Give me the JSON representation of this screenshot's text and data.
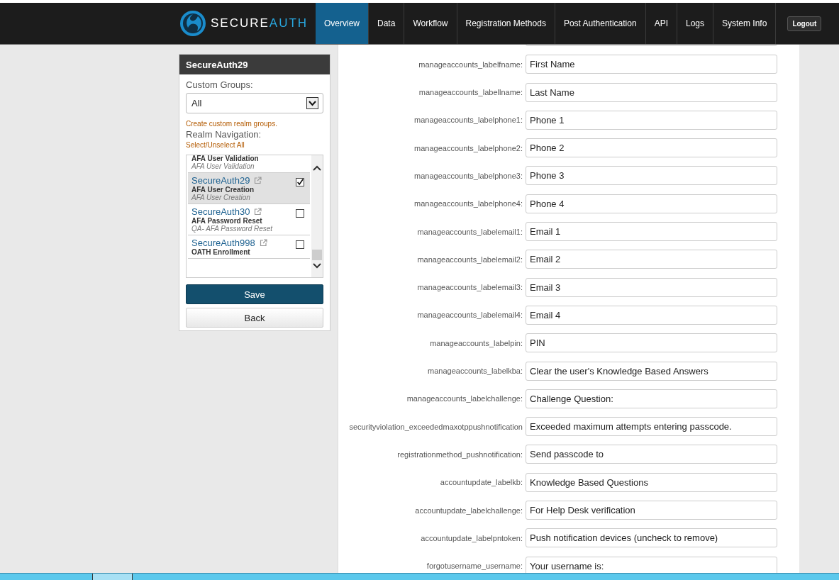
{
  "header": {
    "logo": {
      "word_1": "SECURE",
      "word_2": "AUTH"
    },
    "nav": [
      {
        "label": "Overview",
        "selected": true
      },
      {
        "label": "Data",
        "selected": false
      },
      {
        "label": "Workflow",
        "selected": false
      },
      {
        "label": "Registration Methods",
        "selected": false
      },
      {
        "label": "Post Authentication",
        "selected": false
      },
      {
        "label": "API",
        "selected": false
      },
      {
        "label": "Logs",
        "selected": false
      },
      {
        "label": "System Info",
        "selected": false
      }
    ],
    "logout": "Logout"
  },
  "sidebar": {
    "title": "SecureAuth29",
    "groups_label": "Custom Groups:",
    "groups_value": "All",
    "create_link": "Create custom realm groups.",
    "nav_label": "Realm Navigation:",
    "select_all": "Select/Unselect All",
    "realms": [
      {
        "description": "AFA User Validation",
        "subtitle": "AFA User Validation",
        "selected": false
      },
      {
        "name": "SecureAuth29",
        "description": "AFA User Creation",
        "subtitle": "AFA User Creation",
        "checked": true,
        "selected": true
      },
      {
        "name": "SecureAuth30",
        "description": "AFA Password Reset",
        "subtitle": "QA- AFA Password Reset",
        "checked": false,
        "selected": false
      },
      {
        "name": "SecureAuth998",
        "description": "OATH Enrollment",
        "checked": false,
        "selected": false
      }
    ],
    "save": "Save",
    "back": "Back"
  },
  "form": {
    "rows": [
      {
        "label": "manageaccounts_labelfname:",
        "value": "First Name"
      },
      {
        "label": "manageaccounts_labellname:",
        "value": "Last Name"
      },
      {
        "label": "manageaccounts_labelphone1:",
        "value": "Phone 1"
      },
      {
        "label": "manageaccounts_labelphone2:",
        "value": "Phone 2"
      },
      {
        "label": "manageaccounts_labelphone3:",
        "value": "Phone 3"
      },
      {
        "label": "manageaccounts_labelphone4:",
        "value": "Phone 4"
      },
      {
        "label": "manageaccounts_labelemail1:",
        "value": "Email 1"
      },
      {
        "label": "manageaccounts_labelemail2:",
        "value": "Email 2"
      },
      {
        "label": "manageaccounts_labelemail3:",
        "value": "Email 3"
      },
      {
        "label": "manageaccounts_labelemail4:",
        "value": "Email 4"
      },
      {
        "label": "manageaccounts_labelpin:",
        "value": "PIN"
      },
      {
        "label": "manageaccounts_labelkba:",
        "value": "Clear the user's Knowledge Based Answers"
      },
      {
        "label": "manageaccounts_labelchallenge:",
        "value": "Challenge Question:"
      },
      {
        "label": "securityviolation_exceededmaxotppushnotification",
        "value": "Exceeded maximum attempts entering passcode."
      },
      {
        "label": "registrationmethod_pushnotification:",
        "value": "Send passcode to"
      },
      {
        "label": "accountupdate_labelkb:",
        "value": "Knowledge Based Questions"
      },
      {
        "label": "accountupdate_labelchallenge:",
        "value": "For Help Desk verification"
      },
      {
        "label": "accountupdate_labelpntoken:",
        "value": "Push notification devices (uncheck to remove)"
      },
      {
        "label": "forgotusername_username:",
        "value": "Your username is:"
      }
    ]
  }
}
